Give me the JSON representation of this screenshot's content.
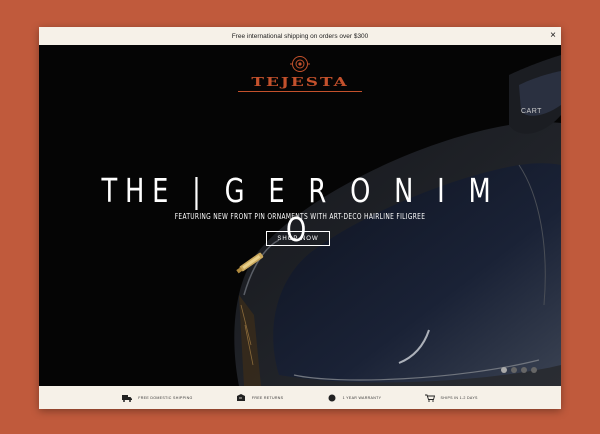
{
  "promo": {
    "text": "Free international shipping on orders over $300",
    "close_symbol": "×"
  },
  "brand": {
    "name": "TEJESTA",
    "color": "#c4512c"
  },
  "hero": {
    "title": "THE | G E R O N I M O",
    "subtitle": "FEATURING NEW FRONT PIN ORNAMENTS WITH ART-DECO HAIRLINE FILIGREE",
    "cta_label": "SHOP NOW",
    "side_text": "CART",
    "slides": [
      {
        "active": true
      },
      {
        "active": false
      },
      {
        "active": false
      },
      {
        "active": false
      }
    ]
  },
  "features": [
    {
      "icon": "truck-icon",
      "label": "FREE DOMESTIC SHIPPING"
    },
    {
      "icon": "return-box-icon",
      "label": "FREE RETURNS"
    },
    {
      "icon": "shield-icon",
      "label": "1 YEAR WARRANTY"
    },
    {
      "icon": "cart-icon",
      "label": "SHIPS IN 1-2 DAYS"
    }
  ]
}
